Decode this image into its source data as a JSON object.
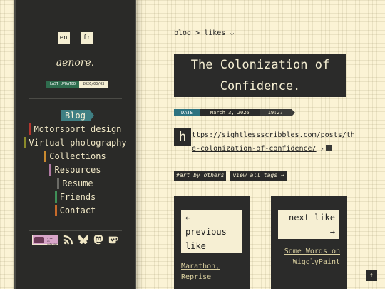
{
  "colors": {
    "sidebar_bg": "#2a2a28",
    "page_bg": "#fbf3d5",
    "active_nav": "#3f7f83",
    "date_label": "#2e7380",
    "updated_label": "#2f6c4e"
  },
  "sidebar": {
    "lang": [
      "en",
      "fr"
    ],
    "site_title": "aenore.",
    "updated": {
      "label": "LAST UPDATED",
      "value": "2026/03/03"
    },
    "nav": [
      {
        "label": "Blog",
        "active": true,
        "color": "#3f7f83"
      },
      {
        "label": "Motorsport design",
        "color": "#b3362f"
      },
      {
        "label": "Virtual photography",
        "color": "#8a8a2a"
      },
      {
        "label": "Collections",
        "color": "#c98a2f"
      },
      {
        "label": "Resources",
        "color": "#b07aa3"
      },
      {
        "label": "Resume",
        "color": "#6b6b66"
      },
      {
        "label": "Friends",
        "color": "#3f8f58"
      },
      {
        "label": "Contact",
        "color": "#c76a2a"
      }
    ],
    "badge_text": "i was an outsider!",
    "socials": [
      "rss-icon",
      "bluesky-icon",
      "mastodon-icon",
      "kofi-icon"
    ]
  },
  "breadcrumb": {
    "blog": "blog",
    "sep": ">",
    "current": "likes",
    "chevron": "⌵"
  },
  "post": {
    "title_line1": "The Colonization of",
    "title_line2": "Confidence.",
    "date_label": "DATE",
    "date": "March 3, 2026",
    "time": "19:27",
    "dropcap": "h",
    "url": "ttps://sightlessscribbles.com/posts/the-colonization-of-confidence/",
    "ext_mark": "↗",
    "tags": [
      "#art by others",
      "view all tags →"
    ]
  },
  "prev": {
    "arrow": "←",
    "label1": "previous",
    "label2": "like",
    "link1": "Marathon,",
    "link2": "Reprise"
  },
  "next": {
    "label1": "next like",
    "arrow": "→",
    "link1": "Some Words on",
    "link2": "WigglyPaint"
  },
  "to_top": "↑"
}
